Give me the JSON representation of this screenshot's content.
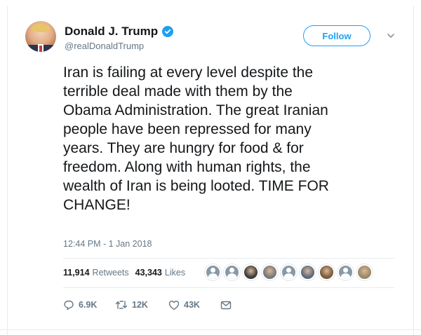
{
  "author": {
    "display_name": "Donald J. Trump",
    "handle": "@realDonaldTrump",
    "verified": true,
    "avatar_icon": "profile-photo"
  },
  "header": {
    "follow_label": "Follow",
    "menu_icon": "chevron-down-icon"
  },
  "tweet": {
    "text": "Iran is failing at every level despite the\nterrible deal made with them by the\nObama Administration. The great Iranian\npeople have been repressed for many\nyears. They are hungry for food & for\nfreedom. Along with human rights, the\nwealth of Iran is being looted. TIME FOR\nCHANGE!",
    "timestamp": "12:44 PM - 1 Jan 2018"
  },
  "stats": {
    "retweets_count": "11,914",
    "retweets_label": "Retweets",
    "likes_count": "43,343",
    "likes_label": "Likes"
  },
  "likers": [
    {
      "type": "default-egg",
      "color": "#8899a6"
    },
    {
      "type": "default-egg",
      "color": "#8899a6"
    },
    {
      "type": "photo",
      "color": "#3b3b3b"
    },
    {
      "type": "photo",
      "color": "#777777"
    },
    {
      "type": "default-egg",
      "color": "#8899a6"
    },
    {
      "type": "photo",
      "color": "#5a6a7c"
    },
    {
      "type": "photo",
      "color": "#7a5a3a"
    },
    {
      "type": "default-egg",
      "color": "#8899a6"
    },
    {
      "type": "photo",
      "color": "#9a8866"
    }
  ],
  "actions": {
    "reply_count": "6.9K",
    "retweet_count": "12K",
    "like_count": "43K",
    "reply_icon": "reply-icon",
    "retweet_icon": "retweet-icon",
    "like_icon": "heart-icon",
    "dm_icon": "envelope-icon"
  },
  "colors": {
    "accent": "#1da1f2",
    "muted_text": "#657786",
    "primary_text": "#14171a",
    "border": "#e6ecf0"
  }
}
